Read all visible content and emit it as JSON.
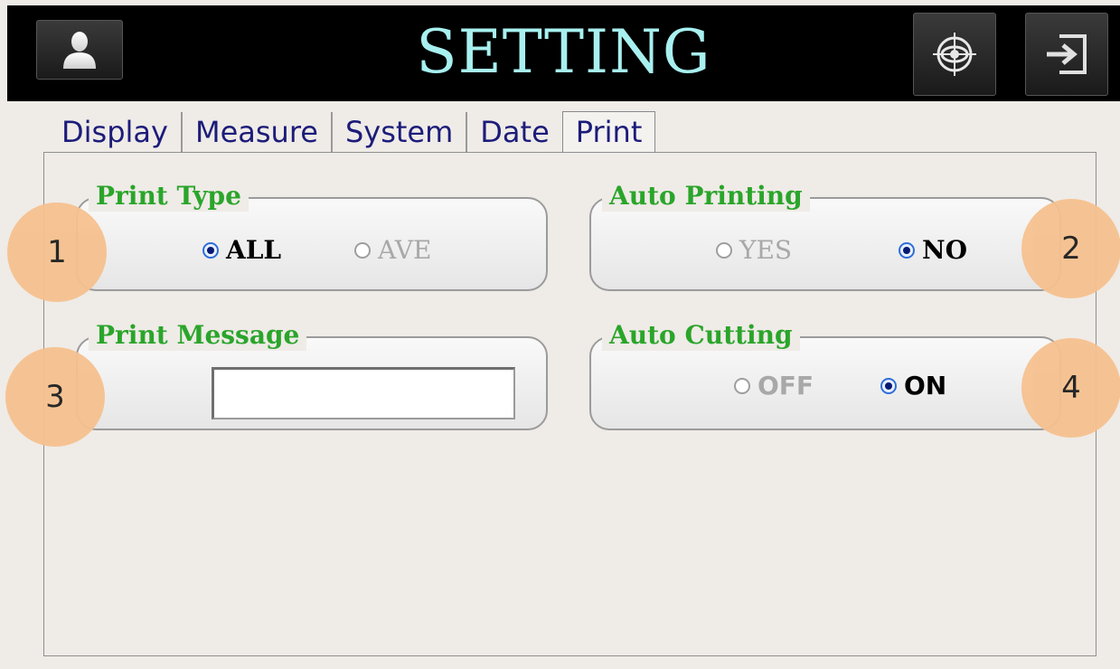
{
  "header": {
    "title": "SETTING",
    "user_button_icon": "user-icon",
    "target_button_icon": "target-icon",
    "exit_button_icon": "exit-icon"
  },
  "tabs": [
    {
      "label": "Display"
    },
    {
      "label": "Measure"
    },
    {
      "label": "System"
    },
    {
      "label": "Date"
    },
    {
      "label": "Print",
      "active": true
    }
  ],
  "groups": {
    "print_type": {
      "label": "Print Type",
      "options": [
        "ALL",
        "AVE"
      ],
      "selected": "ALL"
    },
    "auto_printing": {
      "label": "Auto Printing",
      "options": [
        "YES",
        "NO"
      ],
      "selected": "NO"
    },
    "print_message": {
      "label": "Print Message",
      "value": ""
    },
    "auto_cutting": {
      "label": "Auto Cutting",
      "options": [
        "OFF",
        "ON"
      ],
      "selected": "ON"
    }
  },
  "callouts": [
    "1",
    "2",
    "3",
    "4"
  ],
  "colors": {
    "header_bg": "#000000",
    "title": "#a8f0f0",
    "tab_text": "#1c1c7a",
    "group_label": "#2aa52a",
    "callout": "#f6c18f",
    "background": "#efebe7"
  }
}
